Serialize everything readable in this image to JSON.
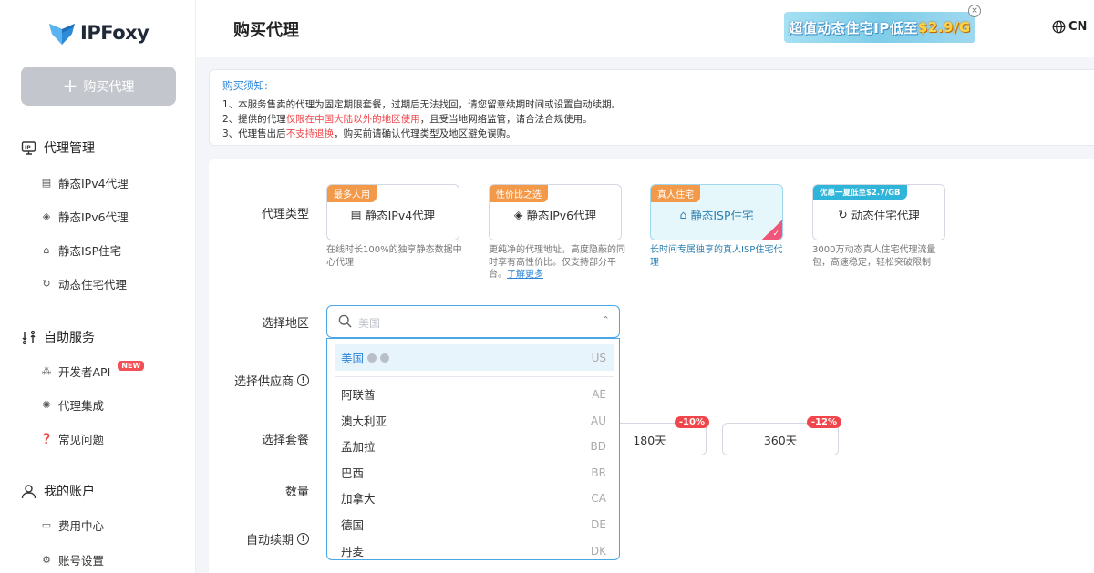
{
  "brand": {
    "name": "IPFoxy"
  },
  "sidebar": {
    "buy_button": {
      "icon": "+",
      "label": "购买代理"
    },
    "groups": [
      {
        "label": "代理管理",
        "icon": "proxy-manage-icon",
        "items": [
          {
            "label": "静态IPv4代理",
            "icon": "server-icon"
          },
          {
            "label": "静态IPv6代理",
            "icon": "layers-icon"
          },
          {
            "label": "静态ISP住宅",
            "icon": "home-icon"
          },
          {
            "label": "动态住宅代理",
            "icon": "refresh-icon"
          }
        ]
      },
      {
        "label": "自助服务",
        "icon": "self-service-icon",
        "items": [
          {
            "label": "开发者API",
            "icon": "api-icon",
            "badge": "NEW"
          },
          {
            "label": "代理集成",
            "icon": "integration-icon"
          },
          {
            "label": "常见问题",
            "icon": "question-icon"
          }
        ]
      },
      {
        "label": "我的账户",
        "icon": "user-icon",
        "items": [
          {
            "label": "费用中心",
            "icon": "card-icon"
          },
          {
            "label": "账号设置",
            "icon": "gear-icon"
          }
        ]
      }
    ]
  },
  "header": {
    "title": "购买代理",
    "promo": {
      "text": "超值动态住宅IP低至",
      "price": "$2.9/G"
    },
    "close_glyph": "×",
    "lang": "CN"
  },
  "notice": {
    "title": "购买须知:",
    "line1": "1、本服务售卖的代理为固定期限套餐，过期后无法找回，请您留意续期时间或设置自动续期。",
    "line2_pre": "2、提供的代理",
    "line2_red": "仅限在中国大陆以外的地区使用",
    "line2_post": "，且受当地网络监管，请合法合规使用。",
    "line3_pre": "3、代理售出后",
    "line3_red": "不支持退换",
    "line3_post": "，购买前请确认代理类型及地区避免误购。"
  },
  "form": {
    "labels": {
      "proxy_type": "代理类型",
      "region": "选择地区",
      "provider": "选择供应商",
      "plan": "选择套餐",
      "quantity": "数量",
      "auto_renew": "自动续期"
    },
    "info_glyph": "!",
    "proxy_types": [
      {
        "tag": "最多人用",
        "tag_color": "#f39a4a",
        "name": "静态IPv4代理",
        "desc": "在线时长100%的独享静态数据中心代理",
        "active": false
      },
      {
        "tag": "性价比之选",
        "tag_color": "#f39a4a",
        "name": "静态IPv6代理",
        "desc": "更纯净的代理地址，高度隐蔽的同时享有高性价比。仅支持部分平台。",
        "link": "了解更多",
        "active": false
      },
      {
        "tag": "真人住宅",
        "tag_color": "#f39a4a",
        "name": "静态ISP住宅",
        "desc": "长时间专属独享的真人ISP住宅代理",
        "active": true
      },
      {
        "tag": "优惠一夏低至$2.7/GB",
        "tag_color": "#2fb5d9",
        "name": "动态住宅代理",
        "desc": "3000万动态真人住宅代理流量包，高速稳定，轻松突破限制",
        "active": false
      }
    ],
    "region_select": {
      "placeholder": "美国",
      "caret": "⌃"
    },
    "regions": [
      {
        "name": "美国",
        "code": "US",
        "selected": true
      },
      {
        "name": "阿联酋",
        "code": "AE"
      },
      {
        "name": "澳大利亚",
        "code": "AU"
      },
      {
        "name": "孟加拉",
        "code": "BD"
      },
      {
        "name": "巴西",
        "code": "BR"
      },
      {
        "name": "加拿大",
        "code": "CA"
      },
      {
        "name": "德国",
        "code": "DE"
      },
      {
        "name": "丹麦",
        "code": "DK"
      }
    ],
    "plans": [
      {
        "label": "180天",
        "badge": "-10%"
      },
      {
        "label": "360天",
        "badge": "-12%"
      }
    ]
  },
  "colors": {
    "accent": "#2b86d9",
    "danger": "#f0454a",
    "tag_orange": "#f39a4a",
    "tag_teal": "#2fb5d9"
  }
}
